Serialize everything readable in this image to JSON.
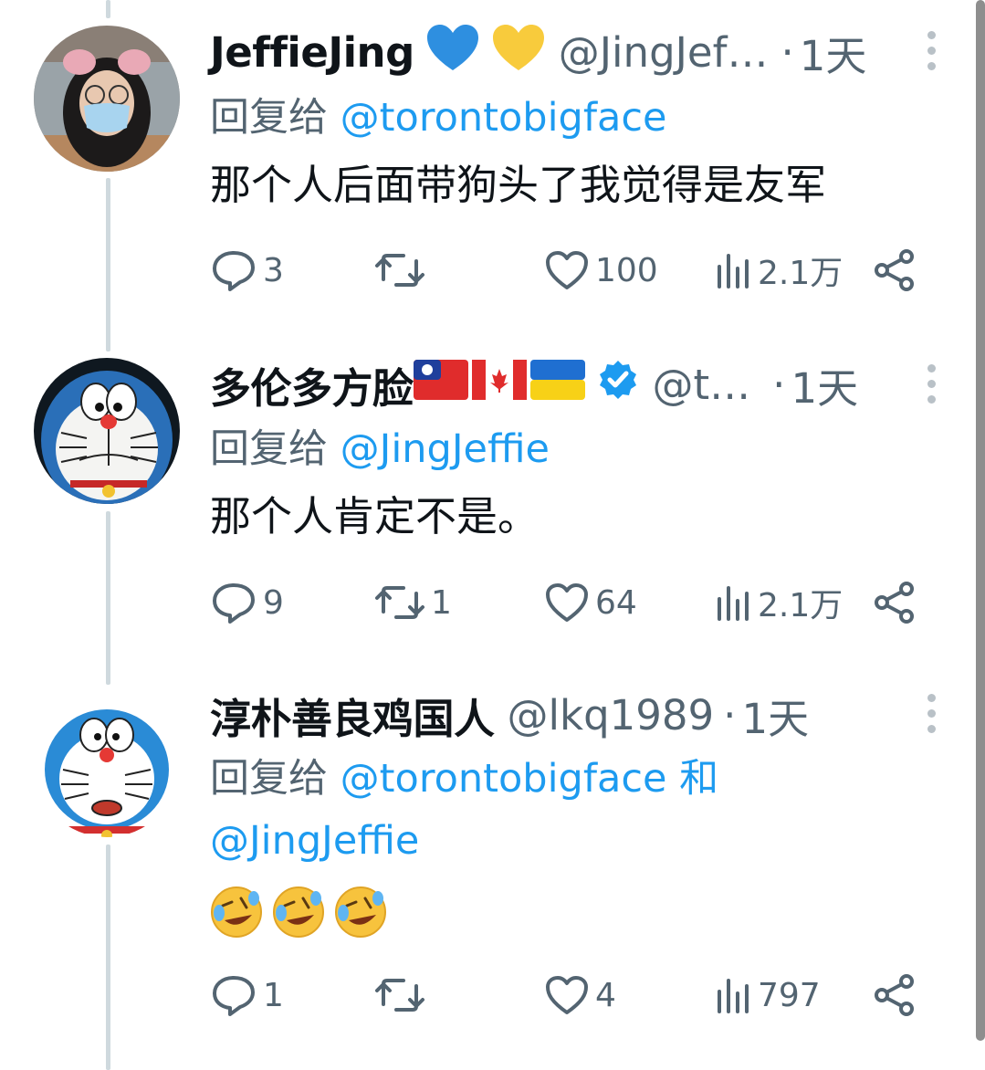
{
  "tweets": [
    {
      "name": "JeffieJing",
      "handle": "@JingJef…",
      "dot": "·",
      "time": "1天",
      "reply_prefix": "回复给",
      "reply_mention": "@torontobigface",
      "text": "那个人后面带狗头了我觉得是友军",
      "icons": [
        "blue-heart-icon",
        "yellow-heart-icon"
      ],
      "replies": "3",
      "retweets": "",
      "likes": "100",
      "views": "2.1万"
    },
    {
      "name": "多伦多方脸",
      "handle": "@t…",
      "dot": "·",
      "time": "1天",
      "reply_prefix": "回复给",
      "reply_mention": "@JingJeffie",
      "text": "那个人肯定不是。",
      "icons": [
        "taiwan-flag-icon",
        "canada-flag-icon",
        "ukraine-flag-icon",
        "verified-badge-icon"
      ],
      "replies": "9",
      "retweets": "1",
      "likes": "64",
      "views": "2.1万"
    },
    {
      "name": "淳朴善良鸡国人",
      "handle": "@lkq1989",
      "dot": "·",
      "time": "1天",
      "reply_prefix": "回复给",
      "reply_mention": "@torontobigface",
      "reply_and": "和",
      "reply_mention2": "@JingJeffie",
      "text_emoji": [
        "rolling-laughing-emoji",
        "rolling-laughing-emoji",
        "rolling-laughing-emoji"
      ],
      "replies": "1",
      "retweets": "",
      "likes": "4",
      "views": "797"
    }
  ],
  "colors": {
    "text": "#0f1419",
    "secondary": "#536471",
    "link": "#1d9bf0",
    "thread_line": "#cfd9de",
    "verified": "#1d9bf0"
  }
}
